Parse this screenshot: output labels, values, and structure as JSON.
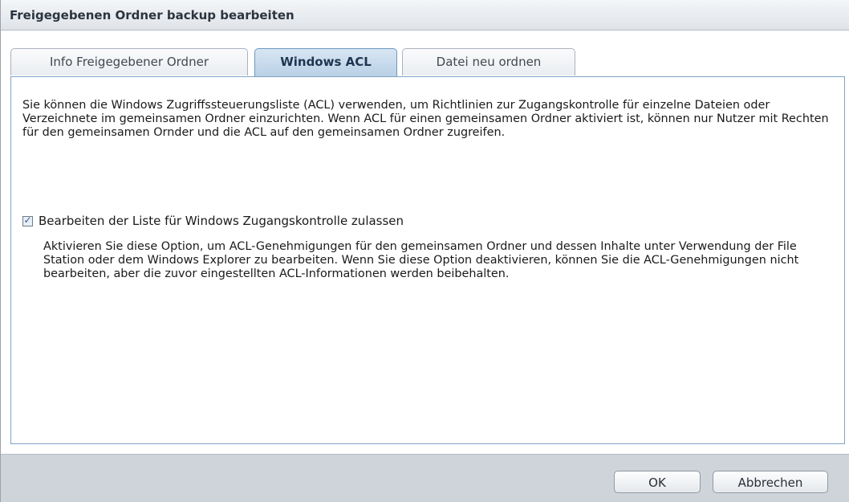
{
  "dialog": {
    "title": "Freigegebenen Ordner backup bearbeiten"
  },
  "tabs": [
    {
      "label": "Info Freigegebener Ordner",
      "active": false
    },
    {
      "label": "Windows ACL",
      "active": true
    },
    {
      "label": "Datei neu ordnen",
      "active": false
    }
  ],
  "acl": {
    "description": "Sie können die Windows Zugriffssteuerungsliste (ACL) verwenden, um Richtlinien zur Zugangskontrolle für einzelne Dateien oder Verzeichnete im gemeinsamen Ordner einzurichten. Wenn ACL für einen gemeinsamen Ordner aktiviert ist, können nur Nutzer mit Rechten für den gemeinsamen Ornder und die ACL auf den gemeinsamen Ordner zugreifen.",
    "checkbox_label": "Bearbeiten der Liste für Windows Zugangskontrolle zulassen",
    "checkbox_checked": true,
    "hint": "Aktivieren Sie diese Option, um ACL-Genehmigungen für den gemeinsamen Ordner und dessen Inhalte unter Verwendung der File Station oder dem Windows Explorer zu bearbeiten. Wenn Sie diese Option deaktivieren, können Sie die ACL-Genehmigungen nicht bearbeiten, aber die zuvor eingestellten ACL-Informationen werden beibehalten."
  },
  "buttons": {
    "ok_label": "OK",
    "cancel_label": "Abbrechen"
  },
  "icons": {
    "checkbox_mark": "check-icon"
  },
  "colors": {
    "active_tab": "#b9d0e6",
    "panel_border": "#7fa3c6",
    "footer_bg": "#cfd4da"
  }
}
